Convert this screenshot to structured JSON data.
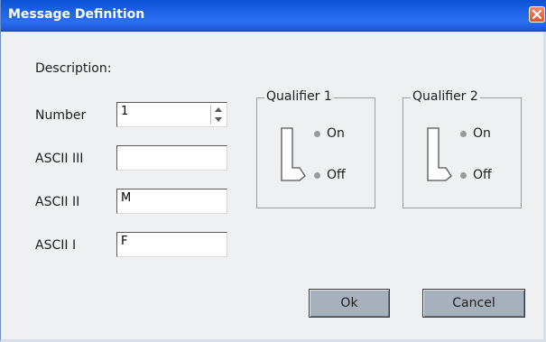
{
  "window": {
    "title": "Message Definition"
  },
  "form": {
    "description_label": "Description:",
    "number_label": "Number",
    "number_value": "1",
    "ascii3_label": "ASCII III",
    "ascii3_value": "",
    "ascii2_label": "ASCII II",
    "ascii2_value": "M",
    "ascii1_label": "ASCII I",
    "ascii1_value": "F"
  },
  "qualifiers": [
    {
      "title": "Qualifier 1",
      "on_label": "On",
      "off_label": "Off",
      "state": "Off"
    },
    {
      "title": "Qualifier 2",
      "on_label": "On",
      "off_label": "Off",
      "state": "Off"
    }
  ],
  "buttons": {
    "ok": "Ok",
    "cancel": "Cancel"
  },
  "icons": {
    "close": "close-icon",
    "spin_up": "spin-up-icon",
    "spin_down": "spin-down-icon"
  }
}
